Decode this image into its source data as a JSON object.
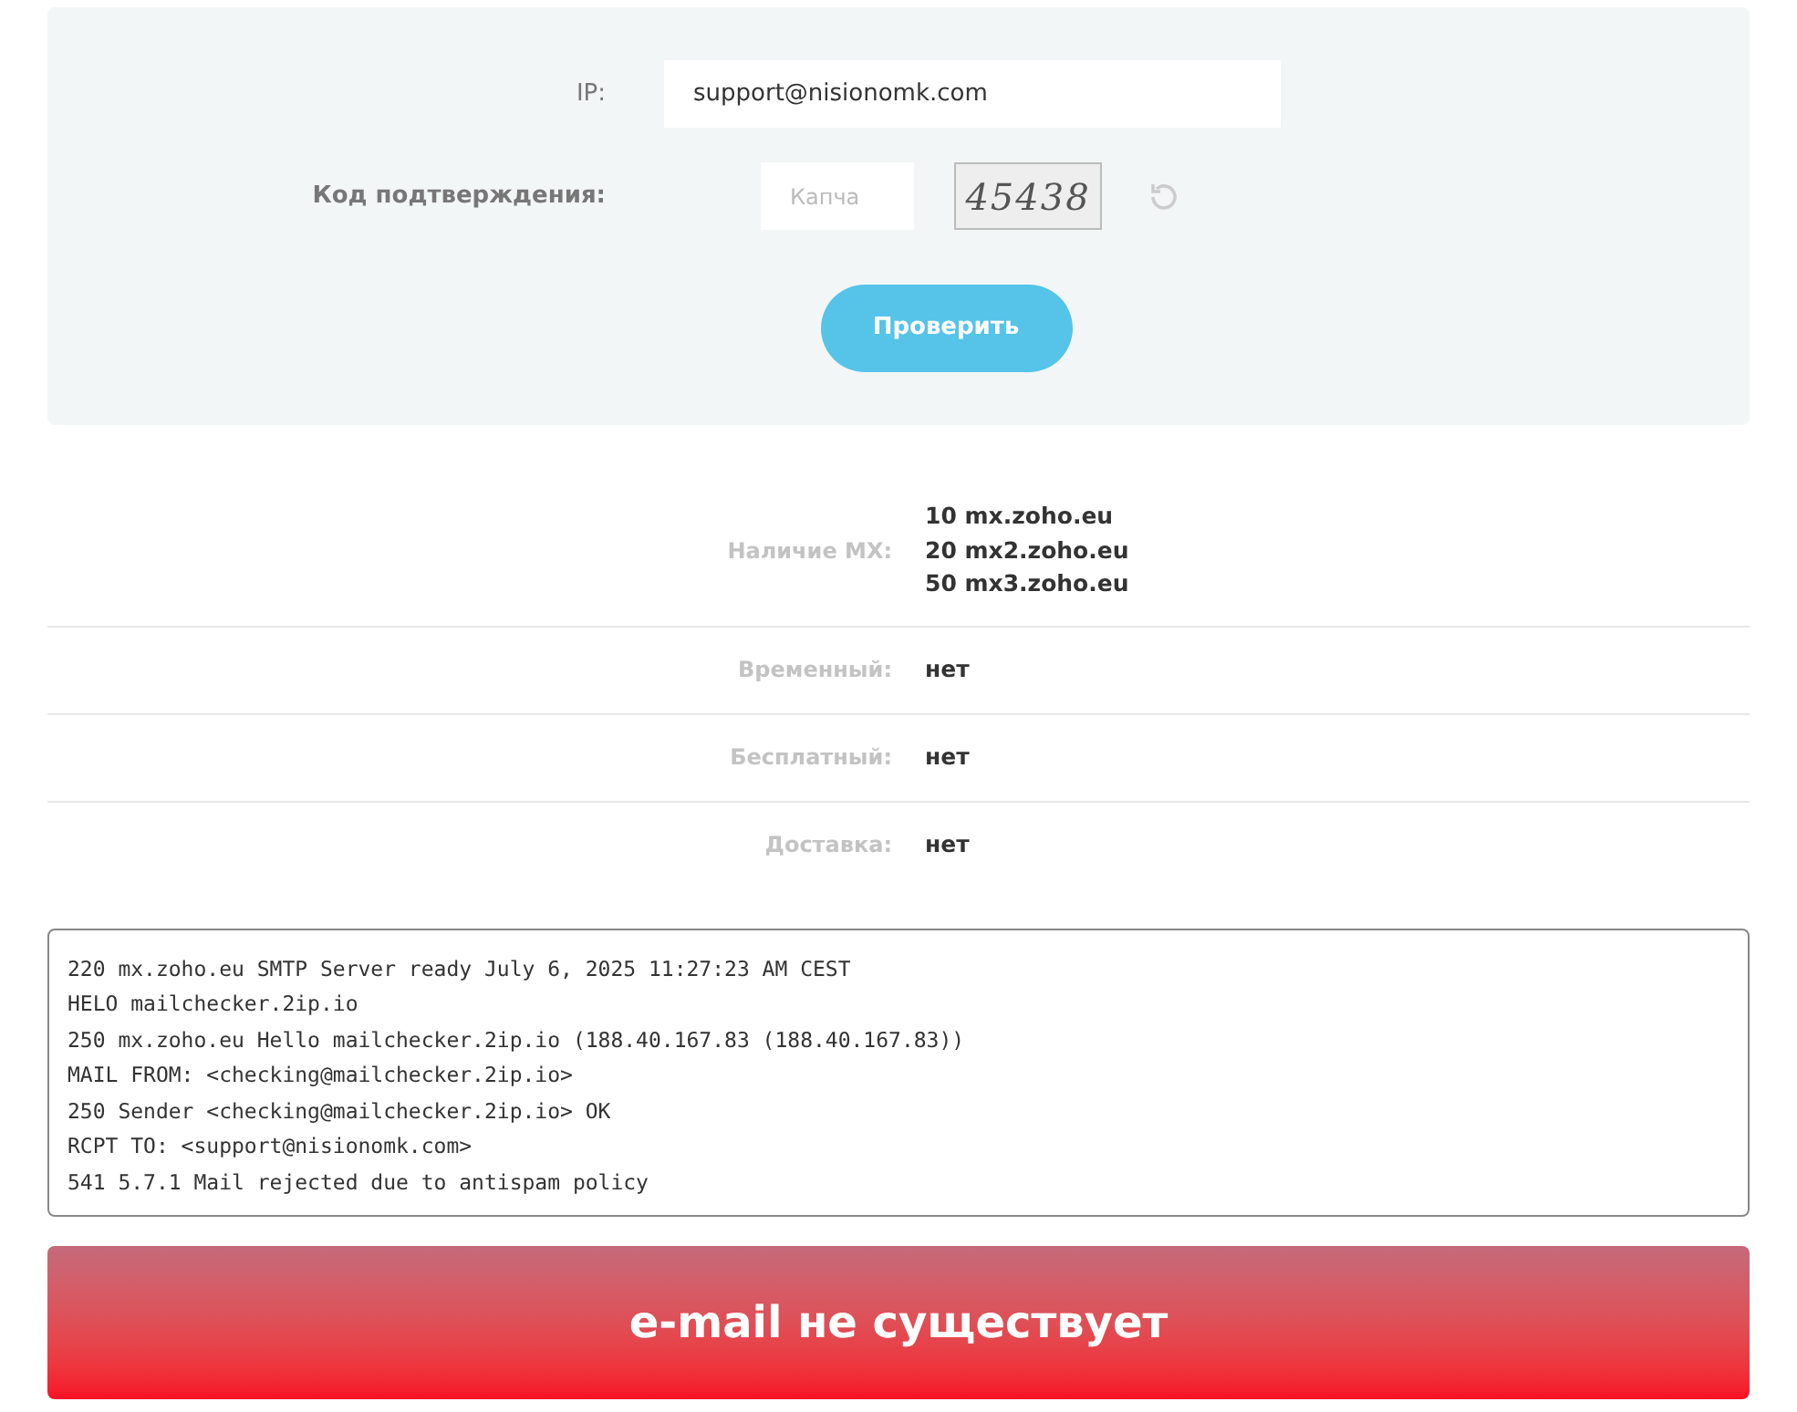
{
  "form": {
    "ip_label": "IP:",
    "ip_value": "support@nisionomk.com",
    "captcha_label": "Код подтверждения:",
    "captcha_placeholder": "Капча",
    "captcha_code": "45438",
    "submit": "Проверить"
  },
  "results": [
    {
      "label": "Наличие MX:",
      "values": [
        "**10** mx.zoho.eu",
        "**20** mx2.zoho.eu",
        "**50** mx3.zoho.eu"
      ]
    },
    {
      "label": "Временный:",
      "values": [
        "нет"
      ]
    },
    {
      "label": "Бесплатный:",
      "values": [
        "нет"
      ]
    },
    {
      "label": "Доставка:",
      "values": [
        "нет"
      ]
    }
  ],
  "log": [
    "220 mx.zoho.eu SMTP Server ready July 6, 2025 11:27:23 AM CEST",
    "HELO mailchecker.2ip.io",
    "250 mx.zoho.eu Hello mailchecker.2ip.io (188.40.167.83 (188.40.167.83))",
    "MAIL FROM: <checking@mailchecker.2ip.io>",
    "250 Sender <checking@mailchecker.2ip.io> OK",
    "RCPT TO: <support@nisionomk.com>",
    "541 5.7.1 Mail rejected due to antispam policy"
  ],
  "verdict": "e-mail не существует"
}
